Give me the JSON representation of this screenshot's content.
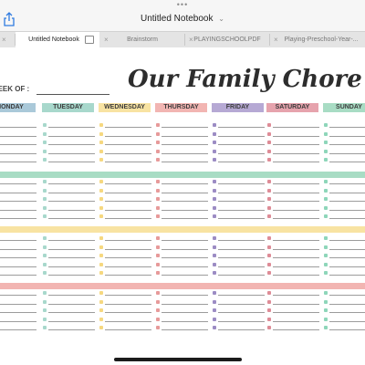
{
  "app": {
    "more_dots": "•••",
    "title": "Untitled Notebook",
    "title_chevron": "⌄"
  },
  "tabs": [
    {
      "label": "Untitled Notebook",
      "active": true
    },
    {
      "label": "Brainstorm",
      "active": false
    },
    {
      "label": "PLAYINGSCHOOLPDF",
      "active": false
    },
    {
      "label": "Playing-Preschool-Year-...",
      "active": false
    }
  ],
  "chart": {
    "title": "Our Family Chore Chart",
    "week_label": "WEEK OF :",
    "days": [
      {
        "name": "MONDAY",
        "color": "#aac9d9"
      },
      {
        "name": "TUESDAY",
        "color": "#a8d8cc"
      },
      {
        "name": "WEDNESDAY",
        "color": "#f8e3a2"
      },
      {
        "name": "THURSDAY",
        "color": "#f2b5b2"
      },
      {
        "name": "FRIDAY",
        "color": "#b6a9d4"
      },
      {
        "name": "SATURDAY",
        "color": "#e6a3ad"
      },
      {
        "name": "SUNDAY",
        "color": "#a8dcc4"
      }
    ],
    "band_colors": [
      "#a8dcc4",
      "#f8e3a2",
      "#f2b5b2"
    ],
    "checkbox_colors": [
      "#a8d8cc",
      "#a8d8cc",
      "#f6d880",
      "#e79a9a",
      "#9c8cc4",
      "#de8c97",
      "#8ed6ba"
    ]
  }
}
